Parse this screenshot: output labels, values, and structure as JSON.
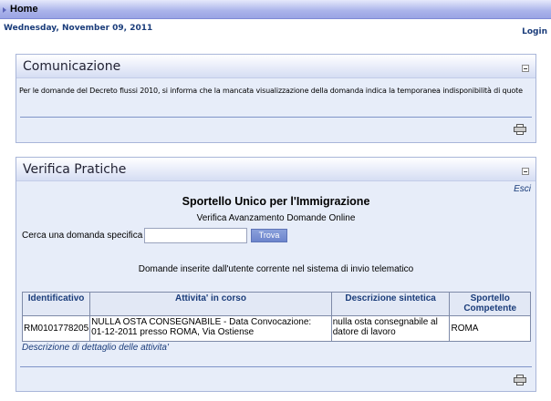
{
  "topbar": {
    "home_label": "Home"
  },
  "header": {
    "date": "Wednesday, November 09, 2011",
    "login_label": "Login"
  },
  "comunicazione": {
    "title": "Comunicazione",
    "message": "Per le domande del Decreto flussi 2010, si informa che la mancata visualizzazione della domanda indica la temporanea indisponibilità di quote"
  },
  "verifica": {
    "title": "Verifica Pratiche",
    "esci_label": "Esci",
    "heading": "Sportello Unico per l'Immigrazione",
    "subheading": "Verifica Avanzamento Domande Online",
    "search_label": "Cerca una domanda specifica",
    "search_value": "",
    "search_button": "Trova",
    "inserted_text": "Domande inserite dall'utente corrente nel sistema di invio telematico",
    "table": {
      "columns": [
        "Identificativo",
        "Attivita' in corso",
        "Descrizione sintetica",
        "Sportello Competente"
      ],
      "rows": [
        {
          "id": "RM0101778205",
          "attivita_line1": "NULLA OSTA CONSEGNABILE - Data Convocazione:",
          "attivita_line2": "01-12-2011 presso ROMA, Via Ostiense",
          "descrizione_line1": "nulla osta consegnabile al",
          "descrizione_line2": "datore di lavoro",
          "sportello": "ROMA"
        }
      ]
    },
    "detail_link": "Descrizione di dettaglio delle attivita'"
  },
  "colors": {
    "link": "#1a3c7a",
    "panel_bg": "#e7edf9",
    "topbar": "#9aa4e4"
  }
}
